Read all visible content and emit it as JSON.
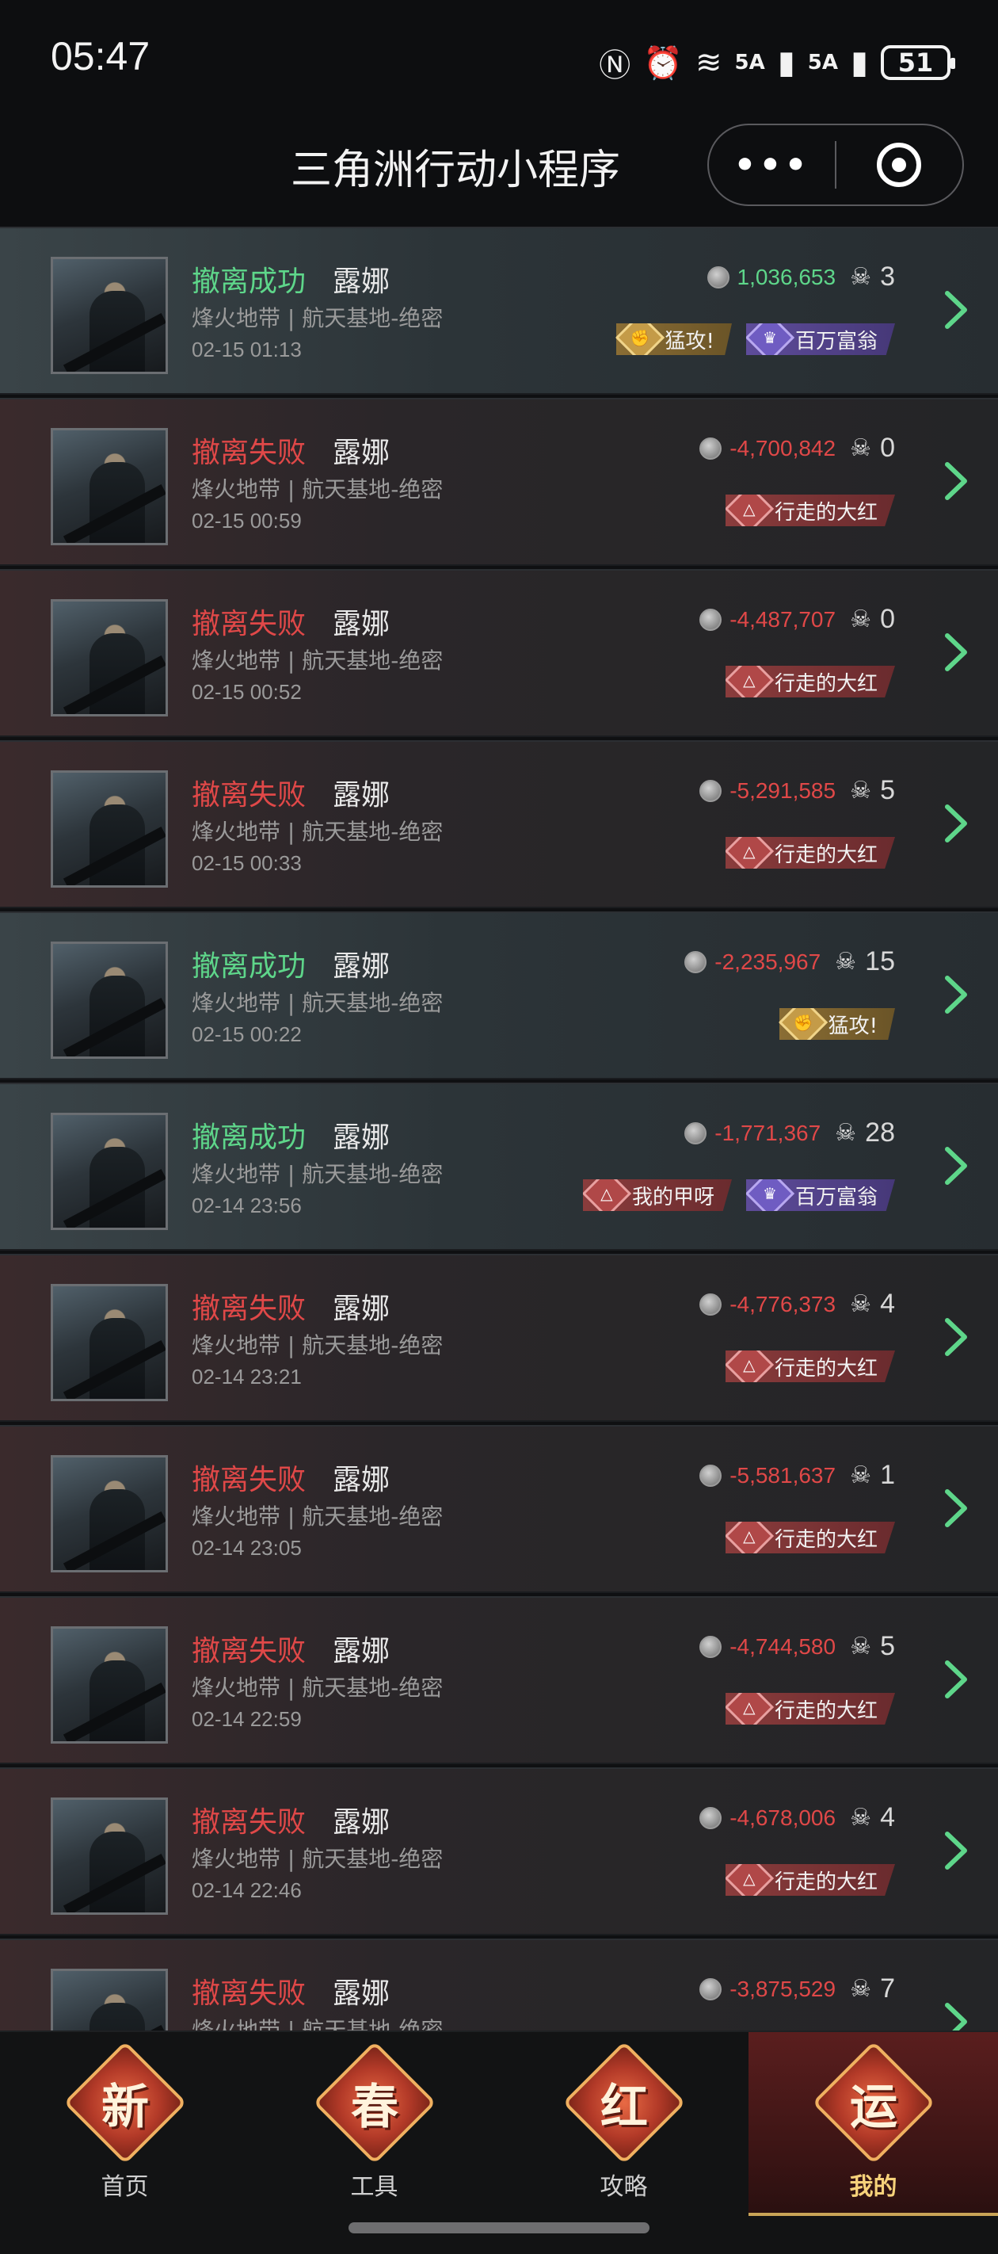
{
  "status_bar": {
    "time": "05:47",
    "network_a": "5A",
    "network_b": "5A",
    "battery": "51"
  },
  "title_bar": {
    "title": "三角洲行动小程序",
    "more_label": "•••"
  },
  "records": [
    {
      "status": "撤离成功",
      "result": "success",
      "character": "露娜",
      "map": "烽火地带 | 航天基地-绝密",
      "time": "02-15 01:13",
      "value": "1,036,653",
      "kills": "3",
      "badges": [
        {
          "label": "猛攻!",
          "style": "gold",
          "icon": "fist-icon"
        },
        {
          "label": "百万富翁",
          "style": "purple",
          "icon": "crown-icon"
        }
      ]
    },
    {
      "status": "撤离失败",
      "result": "fail",
      "character": "露娜",
      "map": "烽火地带 | 航天基地-绝密",
      "time": "02-15 00:59",
      "value": "-4,700,842",
      "kills": "0",
      "badges": [
        {
          "label": "行走的大红",
          "style": "red",
          "icon": "triangle-icon"
        }
      ]
    },
    {
      "status": "撤离失败",
      "result": "fail",
      "character": "露娜",
      "map": "烽火地带 | 航天基地-绝密",
      "time": "02-15 00:52",
      "value": "-4,487,707",
      "kills": "0",
      "badges": [
        {
          "label": "行走的大红",
          "style": "red",
          "icon": "triangle-icon"
        }
      ]
    },
    {
      "status": "撤离失败",
      "result": "fail",
      "character": "露娜",
      "map": "烽火地带 | 航天基地-绝密",
      "time": "02-15 00:33",
      "value": "-5,291,585",
      "kills": "5",
      "badges": [
        {
          "label": "行走的大红",
          "style": "red",
          "icon": "triangle-icon"
        }
      ]
    },
    {
      "status": "撤离成功",
      "result": "success",
      "character": "露娜",
      "map": "烽火地带 | 航天基地-绝密",
      "time": "02-15 00:22",
      "value": "-2,235,967",
      "kills": "15",
      "badges": [
        {
          "label": "猛攻!",
          "style": "gold",
          "icon": "fist-icon"
        }
      ]
    },
    {
      "status": "撤离成功",
      "result": "success",
      "character": "露娜",
      "map": "烽火地带 | 航天基地-绝密",
      "time": "02-14 23:56",
      "value": "-1,771,367",
      "kills": "28",
      "badges": [
        {
          "label": "我的甲呀",
          "style": "red",
          "icon": "triangle-icon"
        },
        {
          "label": "百万富翁",
          "style": "purple",
          "icon": "crown-icon"
        }
      ]
    },
    {
      "status": "撤离失败",
      "result": "fail",
      "character": "露娜",
      "map": "烽火地带 | 航天基地-绝密",
      "time": "02-14 23:21",
      "value": "-4,776,373",
      "kills": "4",
      "badges": [
        {
          "label": "行走的大红",
          "style": "red",
          "icon": "triangle-icon"
        }
      ]
    },
    {
      "status": "撤离失败",
      "result": "fail",
      "character": "露娜",
      "map": "烽火地带 | 航天基地-绝密",
      "time": "02-14 23:05",
      "value": "-5,581,637",
      "kills": "1",
      "badges": [
        {
          "label": "行走的大红",
          "style": "red",
          "icon": "triangle-icon"
        }
      ]
    },
    {
      "status": "撤离失败",
      "result": "fail",
      "character": "露娜",
      "map": "烽火地带 | 航天基地-绝密",
      "time": "02-14 22:59",
      "value": "-4,744,580",
      "kills": "5",
      "badges": [
        {
          "label": "行走的大红",
          "style": "red",
          "icon": "triangle-icon"
        }
      ]
    },
    {
      "status": "撤离失败",
      "result": "fail",
      "character": "露娜",
      "map": "烽火地带 | 航天基地-绝密",
      "time": "02-14 22:46",
      "value": "-4,678,006",
      "kills": "4",
      "badges": [
        {
          "label": "行走的大红",
          "style": "red",
          "icon": "triangle-icon"
        }
      ]
    },
    {
      "status": "撤离失败",
      "result": "fail",
      "character": "露娜",
      "map": "烽火地带 | 航天基地-绝密",
      "time": "",
      "value": "-3,875,529",
      "kills": "7",
      "badges": []
    }
  ],
  "bottom_nav": [
    {
      "emblem": "新",
      "label": "首页",
      "active": false
    },
    {
      "emblem": "春",
      "label": "工具",
      "active": false
    },
    {
      "emblem": "红",
      "label": "攻略",
      "active": false
    },
    {
      "emblem": "运",
      "label": "我的",
      "active": true
    }
  ],
  "colors": {
    "success": "#5ed68a",
    "fail": "#e04848",
    "accent_gold": "#f6d27a"
  }
}
